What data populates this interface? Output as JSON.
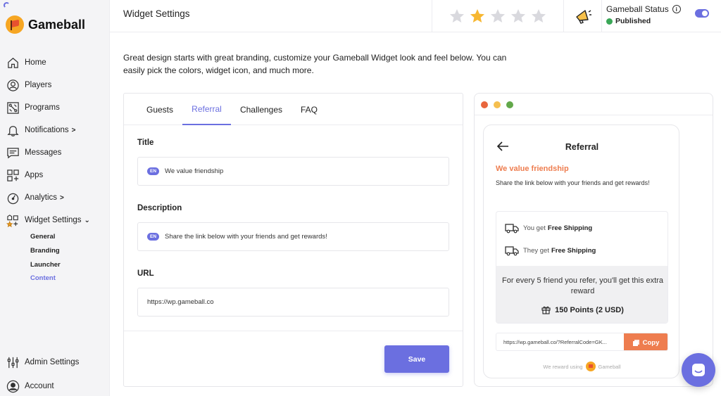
{
  "brand": {
    "name": "Gameball"
  },
  "nav": {
    "items": [
      {
        "label": "Home",
        "icon": "home-icon"
      },
      {
        "label": "Players",
        "icon": "players-icon"
      },
      {
        "label": "Programs",
        "icon": "programs-icon"
      },
      {
        "label": "Notifications",
        "icon": "bell-icon",
        "chevron": ">"
      },
      {
        "label": "Messages",
        "icon": "message-icon"
      },
      {
        "label": "Apps",
        "icon": "apps-icon"
      },
      {
        "label": "Analytics",
        "icon": "analytics-icon",
        "chevron": ">"
      },
      {
        "label": "Widget Settings",
        "icon": "widget-settings-icon",
        "chevron": "⌄"
      }
    ],
    "sub_items": [
      {
        "label": "General",
        "active": false
      },
      {
        "label": "Branding",
        "active": false
      },
      {
        "label": "Launcher",
        "active": false
      },
      {
        "label": "Content",
        "active": true
      }
    ],
    "bottom": [
      {
        "label": "Admin Settings",
        "icon": "sliders-icon"
      },
      {
        "label": "Account",
        "icon": "account-icon"
      }
    ]
  },
  "header": {
    "title": "Widget Settings",
    "rating": {
      "value": 2,
      "max": 5
    },
    "status_title": "Gameball Status",
    "status_value": "Published",
    "status_color": "#3aa757",
    "toggle_on": true
  },
  "intro": "Great design starts with great branding, customize your Gameball Widget look and feel below. You can easily pick the colors, widget icon, and much more.",
  "tabs": [
    {
      "label": "Guests",
      "active": false
    },
    {
      "label": "Referral",
      "active": true
    },
    {
      "label": "Challenges",
      "active": false
    },
    {
      "label": "FAQ",
      "active": false
    }
  ],
  "form": {
    "title_label": "Title",
    "title_lang": "EN",
    "title_value": "We value friendship",
    "description_label": "Description",
    "description_lang": "EN",
    "description_value": "Share the link below with your friends and get rewards!",
    "url_label": "URL",
    "url_value": "https://wp.gameball.co",
    "save_label": "Save"
  },
  "preview": {
    "window_dots": [
      "#e8663d",
      "#f5bf4f",
      "#62a84a"
    ],
    "title": "Referral",
    "heading": "We value friendship",
    "description": "Share the link below with your friends and get rewards!",
    "you_get_prefix": "You get",
    "you_get_reward": "Free Shipping",
    "they_get_prefix": "They get",
    "they_get_reward": "Free Shipping",
    "extra_text": "For every 5 friend you refer, you'll get this extra reward",
    "extra_points": "150 Points (2 USD)",
    "referral_link": "https://wp.gameball.co/?ReferralCode=GK...",
    "copy_label": "Copy",
    "powered_prefix": "We reward using",
    "powered_brand": "Gameball"
  },
  "colors": {
    "accent": "#6b6fe0",
    "orange": "#ee7d4f"
  }
}
